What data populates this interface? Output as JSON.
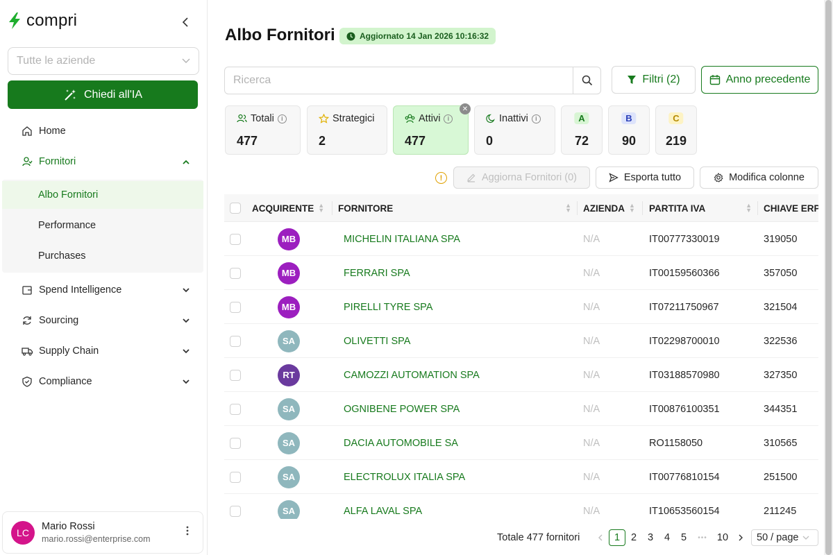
{
  "brand": {
    "name": "compri"
  },
  "sidebar": {
    "company_select": {
      "placeholder": "Tutte le aziende"
    },
    "ai_button": "Chiedi all'IA",
    "nav": {
      "home": "Home",
      "fornitori": "Fornitori",
      "spend": "Spend Intelligence",
      "sourcing": "Sourcing",
      "supply_chain": "Supply Chain",
      "compliance": "Compliance"
    },
    "submenu": {
      "albo": "Albo Fornitori",
      "performance": "Performance",
      "purchases": "Purchases"
    },
    "user": {
      "initials": "LC",
      "name": "Mario Rossi",
      "email": "mario.rossi@enterprise.com"
    }
  },
  "header": {
    "title": "Albo Fornitori",
    "updated": "Aggiornato 14 Jan 2026 10:16:32"
  },
  "search": {
    "placeholder": "Ricerca"
  },
  "filters": {
    "filter_label": "Filtri (2)",
    "prev_year_label": "Anno precedente"
  },
  "stats": {
    "totali": {
      "label": "Totali",
      "value": "477"
    },
    "strategici": {
      "label": "Strategici",
      "value": "2"
    },
    "attivi": {
      "label": "Attivi",
      "value": "477"
    },
    "inattivi": {
      "label": "Inattivi",
      "value": "0"
    },
    "a": {
      "label": "A",
      "value": "72"
    },
    "b": {
      "label": "B",
      "value": "90"
    },
    "c": {
      "label": "C",
      "value": "219"
    }
  },
  "toolbar": {
    "update": "Aggiorna Fornitori (0)",
    "export": "Esporta tutto",
    "columns": "Modifica colonne"
  },
  "table": {
    "headers": {
      "buyer": "ACQUIRENTE",
      "supplier": "FORNITORE",
      "company": "AZIENDA",
      "vat": "PARTITA IVA",
      "erp": "CHIAVE ERP"
    },
    "rows": [
      {
        "buyer": "MB",
        "buyer_color": "#9c1fbf",
        "supplier": "MICHELIN ITALIANA SPA",
        "company": "N/A",
        "vat": "IT00777330019",
        "erp": "319050"
      },
      {
        "buyer": "MB",
        "buyer_color": "#9c1fbf",
        "supplier": "FERRARI SPA",
        "company": "N/A",
        "vat": "IT00159560366",
        "erp": "357050"
      },
      {
        "buyer": "MB",
        "buyer_color": "#9c1fbf",
        "supplier": "PIRELLI TYRE SPA",
        "company": "N/A",
        "vat": "IT07211750967",
        "erp": "321504"
      },
      {
        "buyer": "SA",
        "buyer_color": "#8fb7bd",
        "supplier": "OLIVETTI SPA",
        "company": "N/A",
        "vat": "IT02298700010",
        "erp": "322536"
      },
      {
        "buyer": "RT",
        "buyer_color": "#6a3a9e",
        "supplier": "CAMOZZI AUTOMATION SPA",
        "company": "N/A",
        "vat": "IT03188570980",
        "erp": "327350"
      },
      {
        "buyer": "SA",
        "buyer_color": "#8fb7bd",
        "supplier": "OGNIBENE POWER SPA",
        "company": "N/A",
        "vat": "IT00876100351",
        "erp": "344351"
      },
      {
        "buyer": "SA",
        "buyer_color": "#8fb7bd",
        "supplier": "DACIA AUTOMOBILE SA",
        "company": "N/A",
        "vat": "RO1158050",
        "erp": "310565"
      },
      {
        "buyer": "SA",
        "buyer_color": "#8fb7bd",
        "supplier": "ELECTROLUX ITALIA SPA",
        "company": "N/A",
        "vat": "IT00776810154",
        "erp": "251500"
      },
      {
        "buyer": "SA",
        "buyer_color": "#8fb7bd",
        "supplier": "ALFA LAVAL SPA",
        "company": "N/A",
        "vat": "IT10653560154",
        "erp": "211245"
      }
    ]
  },
  "pagination": {
    "total": "Totale 477 fornitori",
    "pages": [
      "1",
      "2",
      "3",
      "4",
      "5"
    ],
    "ellipsis": "•••",
    "last": "10",
    "page_size": "50 / page"
  },
  "colors": {
    "accent": "#177a1d",
    "badge_bg": "#d2f4cd",
    "active_card": "#d8f8d6"
  }
}
